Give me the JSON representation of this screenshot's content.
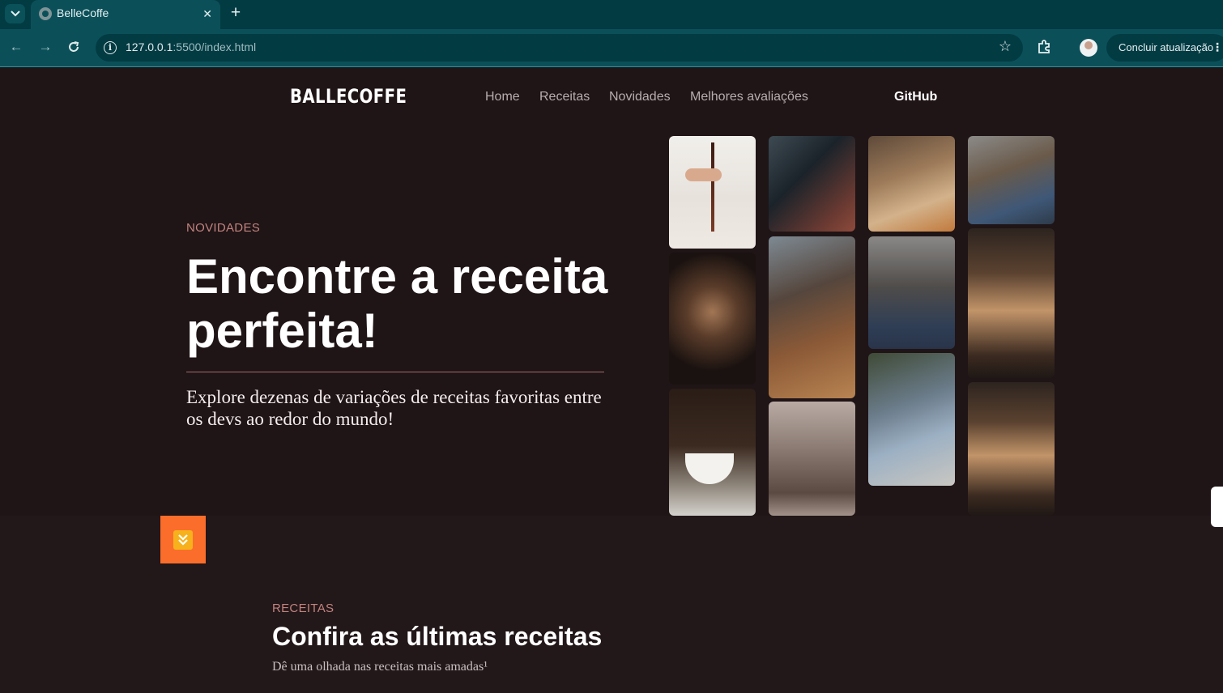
{
  "browser": {
    "tab_title": "BelleCoffe",
    "url_host": "127.0.0.1",
    "url_rest": ":5500/index.html",
    "update_label": "Concluir atualização",
    "icons": [
      "tab-search-icon",
      "favicon-icon",
      "close-icon",
      "plus-icon",
      "back-icon",
      "forward-icon",
      "reload-icon",
      "info-icon",
      "star-icon",
      "extensions-icon",
      "profile-avatar",
      "menu-icon"
    ]
  },
  "header": {
    "logo": "BALLECOFFE",
    "nav": [
      "Home",
      "Receitas",
      "Novidades",
      "Melhores avaliações"
    ],
    "github": "GitHub"
  },
  "hero": {
    "eyebrow": "NOVIDADES",
    "title": "Encontre a receita perfeita!",
    "description": "Explore dezenas de variações de receitas favoritas entre os devs ao redor do mundo!"
  },
  "gallery": {
    "photos": [
      "coffee-pour-hand",
      "programmer-coding",
      "woman-barista",
      "people-meeting-table",
      "latte-art-pour",
      "cafe-window-table",
      "baristas-espresso-machine",
      "woman-drinking-coffee",
      "espresso-cup-drip",
      "hand-cup-steam",
      "man-laptop-cafe",
      "woman-drinking-coffee-2"
    ]
  },
  "recipes_section": {
    "eyebrow": "RECEITAS",
    "title": "Confira as últimas receitas",
    "subtitle": "Dê uma olhada nas receitas mais amadas¹"
  },
  "colors": {
    "page_bg": "#1f1416",
    "accent": "#c2837e",
    "scroll_button": "#fb6d2b"
  }
}
